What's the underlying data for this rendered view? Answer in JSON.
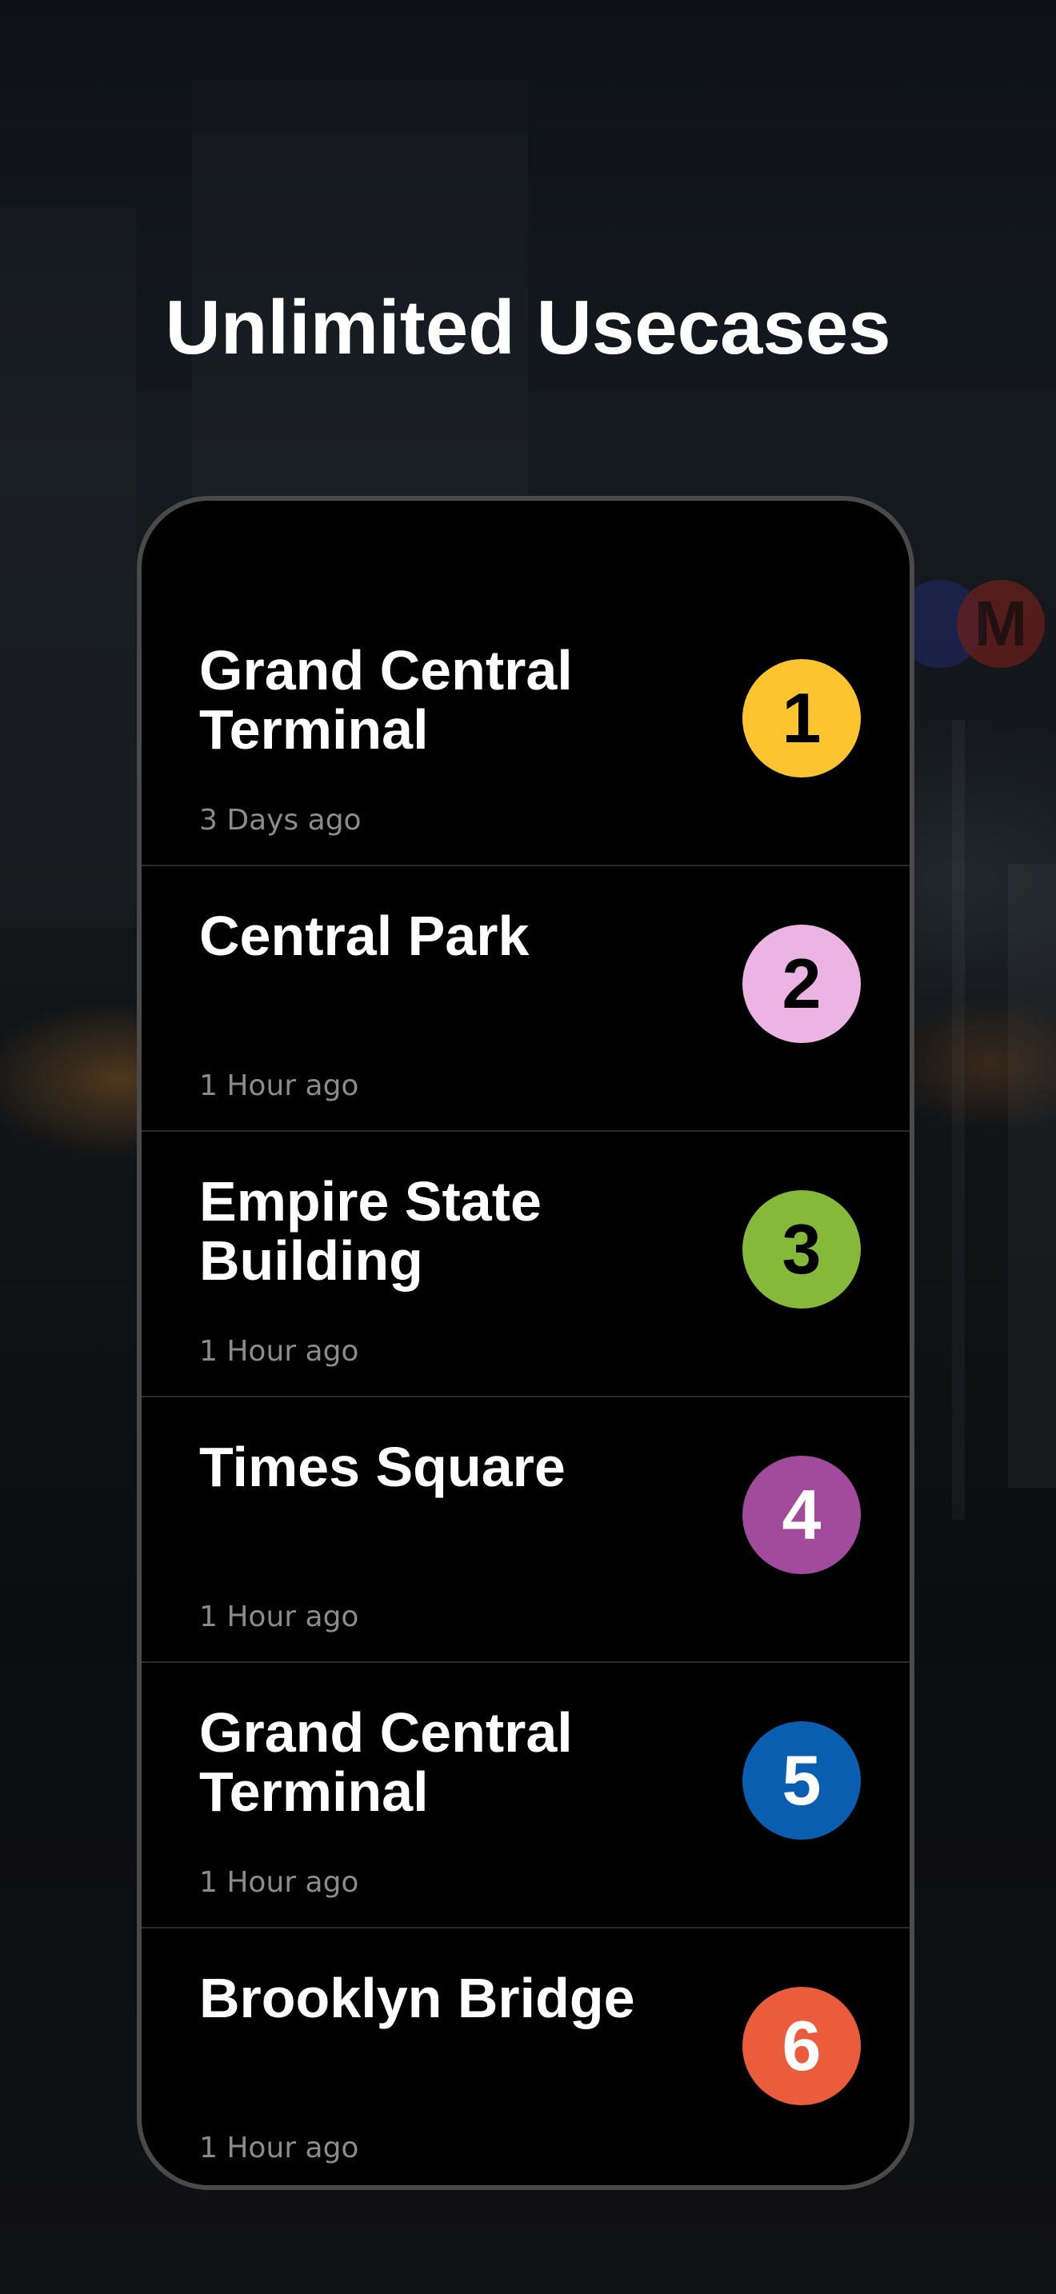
{
  "header": {
    "title": "Unlimited Usecases"
  },
  "background": {
    "signs": [
      {
        "letter": "",
        "color": "#2a3a8a"
      },
      {
        "letter": "M",
        "color": "#8c2a24"
      }
    ]
  },
  "items": [
    {
      "title": "Grand Central Terminal",
      "time": "3 Days ago",
      "number": "1",
      "color": "#fcc42e",
      "text_color": "#000000"
    },
    {
      "title": "Central Park",
      "time": "1 Hour ago",
      "number": "2",
      "color": "#ebb4e3",
      "text_color": "#000000"
    },
    {
      "title": "Empire State Building",
      "time": "1 Hour ago",
      "number": "3",
      "color": "#86b93a",
      "text_color": "#000000"
    },
    {
      "title": "Times Square",
      "time": "1 Hour ago",
      "number": "4",
      "color": "#a24b9c",
      "text_color": "#ffffff"
    },
    {
      "title": "Grand Central Terminal",
      "time": "1 Hour ago",
      "number": "5",
      "color": "#0a5eb0",
      "text_color": "#ffffff"
    },
    {
      "title": "Brooklyn Bridge",
      "time": "1 Hour ago",
      "number": "6",
      "color": "#ea5c3c",
      "text_color": "#ffffff"
    }
  ]
}
